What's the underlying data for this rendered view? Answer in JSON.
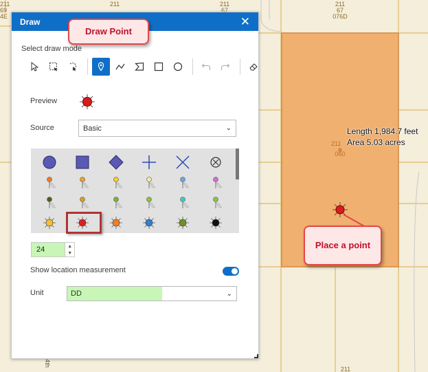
{
  "panel": {
    "title": "Draw",
    "close_glyph": "✕",
    "select_mode_label": "Select draw mode",
    "preview_label": "Preview",
    "source_label": "Source",
    "source_value": "Basic",
    "size_value": "24",
    "show_location_label": "Show location measurement",
    "show_location_enabled": true,
    "unit_label": "Unit",
    "unit_value": "DD",
    "tools": [
      "select-pointer",
      "lasso-rectangle",
      "lasso-freehand",
      "point",
      "polyline",
      "polygon",
      "rectangle",
      "circle",
      "undo",
      "redo",
      "eraser"
    ],
    "active_tool": "point"
  },
  "callouts": {
    "draw_point": "Draw Point",
    "place_point": "Place a point"
  },
  "measurement": {
    "length": "Length 1,984.7 feet",
    "area": "Area 5.03 acres"
  },
  "map_labels": {
    "top_left": [
      "211",
      "69",
      "4E"
    ],
    "top_mid": [
      "211",
      "67"
    ],
    "top_right": [
      "211",
      "67",
      "076D"
    ],
    "parcel": [
      "211",
      "060"
    ],
    "bottom": "211",
    "road": "4th"
  },
  "colors": {
    "accent": "#0f6fc6",
    "parcel_fill": "#f0b06f",
    "parcel_border": "#d28a45",
    "callout_border": "#e34848",
    "callout_text": "#c0112b",
    "highlight": "#c7f6b6"
  },
  "symbols": {
    "row1": [
      "circle-shape",
      "square-shape",
      "diamond-shape",
      "plus-shape",
      "x-shape",
      "circle-x-shape"
    ],
    "row2_pin_colors": [
      "#f07a2a",
      "#f0a020",
      "#f4d020",
      "#f2e8a0",
      "#6aa8e0",
      "#d070d0"
    ],
    "row3_pin_colors": [
      "#5a5a20",
      "#d8a020",
      "#80b040",
      "#90c040",
      "#40c8c0",
      "#90c050"
    ],
    "row4_sun_colors": [
      "#f4c030",
      "#d82020",
      "#f08020",
      "#3080d0",
      "#709020",
      "#111111"
    ],
    "selected": "red-sun-marker"
  }
}
